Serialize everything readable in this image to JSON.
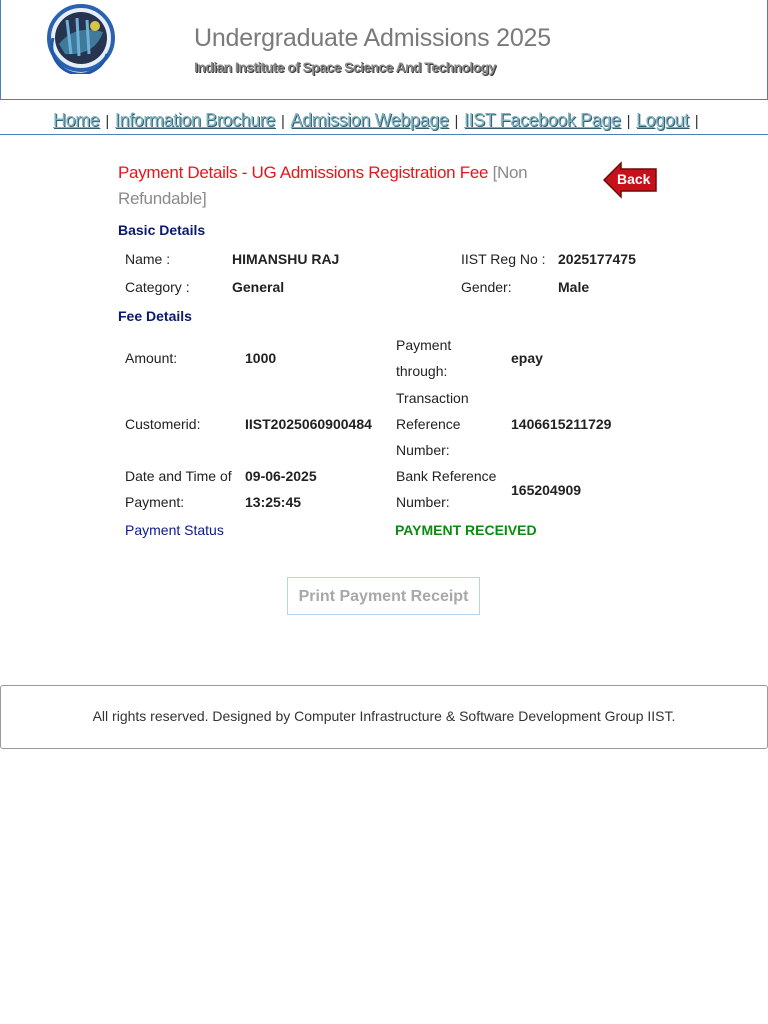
{
  "header": {
    "title": "Undergraduate Admissions 2025",
    "subtitle": "Indian Institute of Space Science And Technology",
    "logo_icon": "iist-logo-icon"
  },
  "nav": {
    "items": [
      "Home",
      "Information Brochure",
      "Admission Webpage",
      "IIST Facebook Page",
      "Logout"
    ],
    "separator": "|"
  },
  "payment": {
    "title": "Payment Details - UG Admissions Registration Fee",
    "title_suffix": "[Non Refundable]",
    "back_label": "Back",
    "colors": {
      "title": "#e8141b",
      "back_button": "#c8101a",
      "status": "#0e8a12"
    }
  },
  "basic": {
    "heading": "Basic Details",
    "name_label": "Name :",
    "name_value": "HIMANSHU RAJ",
    "reg_label": "IIST Reg No :",
    "reg_value": "2025177475",
    "category_label": "Category :",
    "category_value": "General",
    "gender_label": "Gender:",
    "gender_value": "Male"
  },
  "fee": {
    "heading": "Fee Details",
    "amount_label": "Amount:",
    "amount_value": "1000",
    "through_label": "Payment through:",
    "through_value": "epay",
    "customer_label": "Customerid:",
    "customer_value": "IIST2025060900484",
    "txn_label": "Transaction Reference Number:",
    "txn_value": "1406615211729",
    "datetime_label": "Date and Time of Payment:",
    "datetime_value": "09-06-2025 13:25:45",
    "bankref_label": "Bank Reference Number:",
    "bankref_value": "165204909",
    "status_label": "Payment Status",
    "status_value": "PAYMENT RECEIVED"
  },
  "actions": {
    "print_label": "Print Payment Receipt"
  },
  "footer": {
    "text": "All rights reserved. Designed by Computer Infrastructure & Software Development Group IIST."
  }
}
